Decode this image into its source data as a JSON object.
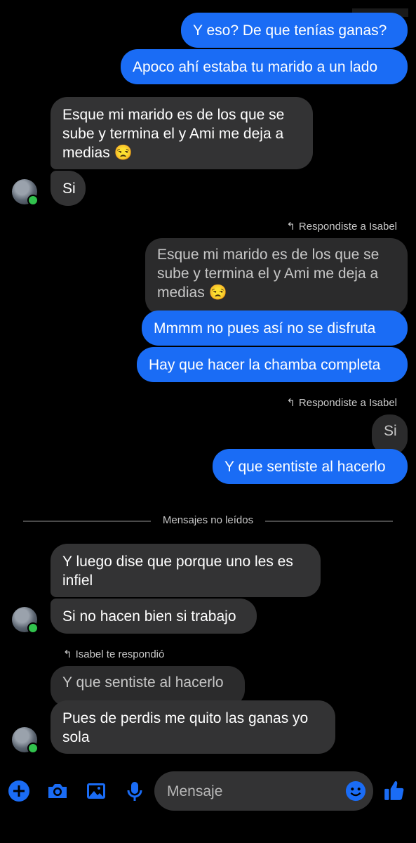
{
  "colors": {
    "accent": "#1a6cf5",
    "incoming_bubble": "#333334",
    "quoted_bubble": "#2b2b2c",
    "online": "#31c24d",
    "background": "#000000"
  },
  "messages": {
    "m1": "Y eso? De que tenías ganas?",
    "m2": "Apoco ahí estaba tu marido a un lado",
    "m3": "Esque mi marido es de los que se sube y termina el y Ami me deja a medias 😒",
    "m4": "Si",
    "reply1_note": "Respondiste a Isabel",
    "m5_quoted": "Esque mi marido es de los que se sube y termina el y Ami me deja a medias 😒",
    "m6": "Mmmm no pues así no se disfruta",
    "m7": "Hay que hacer la chamba completa",
    "reply2_note": "Respondiste a Isabel",
    "m8_quoted": "Si",
    "m9": "Y que sentiste al hacerlo",
    "unread_divider": "Mensajes no leídos",
    "m10": "Y luego dise que porque uno les es infiel",
    "m11": "Si no hacen bien si trabajo",
    "reply3_note": "Isabel te respondió",
    "m12_quoted": "Y que sentiste al hacerlo",
    "m13": "Pues de perdis me quito las ganas yo sola"
  },
  "composer": {
    "placeholder": "Mensaje"
  },
  "icons": {
    "plus": "plus-icon",
    "camera": "camera-icon",
    "gallery": "image-icon",
    "mic": "microphone-icon",
    "emoji": "emoji-icon",
    "like": "thumbs-up-icon"
  }
}
